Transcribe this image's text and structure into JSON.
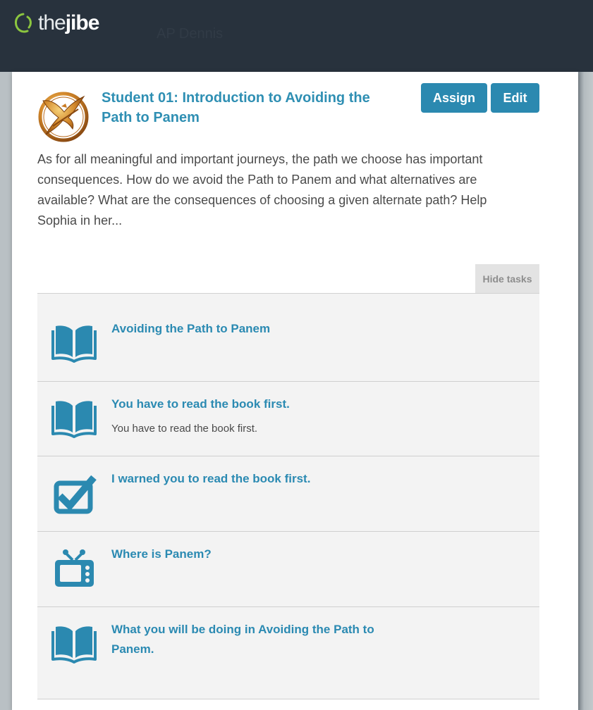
{
  "header": {
    "logo_light": "the",
    "logo_bold": "jibe",
    "nav_text": "AP Dennis"
  },
  "activity": {
    "title": "Student 01: Introduction to Avoiding the Path to Panem",
    "assign_label": "Assign",
    "edit_label": "Edit",
    "description": "As for all meaningful and important journeys, the path we choose has important consequences.  How do we avoid the Path to Panem and what alternatives are available? What are the consequences of choosing a given alternate path? Help Sophia in her..."
  },
  "tasks_section": {
    "toggle_label": "Hide tasks",
    "items": [
      {
        "icon": "book-icon",
        "title": "Avoiding the Path to Panem",
        "subtitle": ""
      },
      {
        "icon": "book-icon",
        "title": "You have to read the book first.",
        "subtitle": "You have to read the book first."
      },
      {
        "icon": "checkbox-icon",
        "title": "I warned you to read the book first.",
        "subtitle": ""
      },
      {
        "icon": "tv-icon",
        "title": "Where is Panem?",
        "subtitle": ""
      },
      {
        "icon": "book-icon",
        "title": "What you will be doing in Avoiding the Path to Panem.",
        "subtitle": ""
      }
    ]
  },
  "colors": {
    "header_bg": "#28323d",
    "accent": "#2b89b0",
    "logo_green": "#8cc63f",
    "task_bg": "#f3f3f3"
  }
}
